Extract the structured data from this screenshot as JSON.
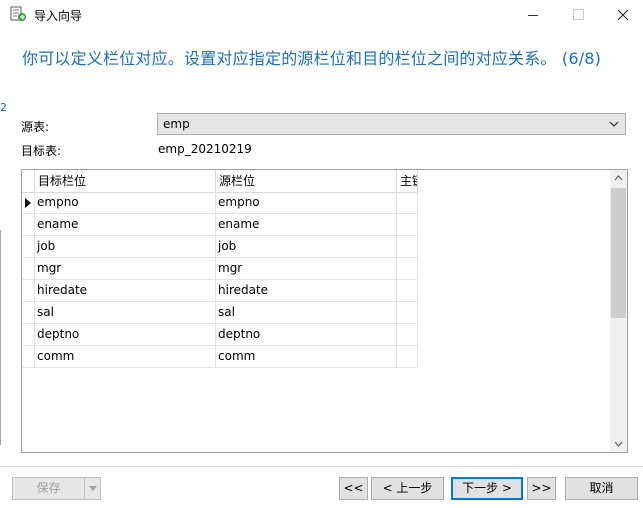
{
  "window": {
    "title": "导入向导"
  },
  "heading": "你可以定义栏位对应。设置对应指定的源栏位和目的栏位之间的对应关系。 (6/8)",
  "side_mark": "2",
  "source_table": {
    "label": "源表:",
    "value": "emp"
  },
  "target_table": {
    "label": "目标表:",
    "value": "emp_20210219"
  },
  "grid": {
    "columns": {
      "target": "目标栏位",
      "source": "源栏位",
      "pk": "主键"
    },
    "rows": [
      {
        "target": "empno",
        "source": "empno"
      },
      {
        "target": "ename",
        "source": "ename"
      },
      {
        "target": "job",
        "source": "job"
      },
      {
        "target": "mgr",
        "source": "mgr"
      },
      {
        "target": "hiredate",
        "source": "hiredate"
      },
      {
        "target": "sal",
        "source": "sal"
      },
      {
        "target": "deptno",
        "source": "deptno"
      },
      {
        "target": "comm",
        "source": "comm"
      }
    ]
  },
  "buttons": {
    "save": "保存",
    "first": "<<",
    "prev": "< 上一步",
    "next": "下一步 >",
    "last": ">>",
    "cancel": "取消"
  },
  "colors": {
    "heading": "#1a6fbf",
    "focus_border": "#0078d7"
  }
}
